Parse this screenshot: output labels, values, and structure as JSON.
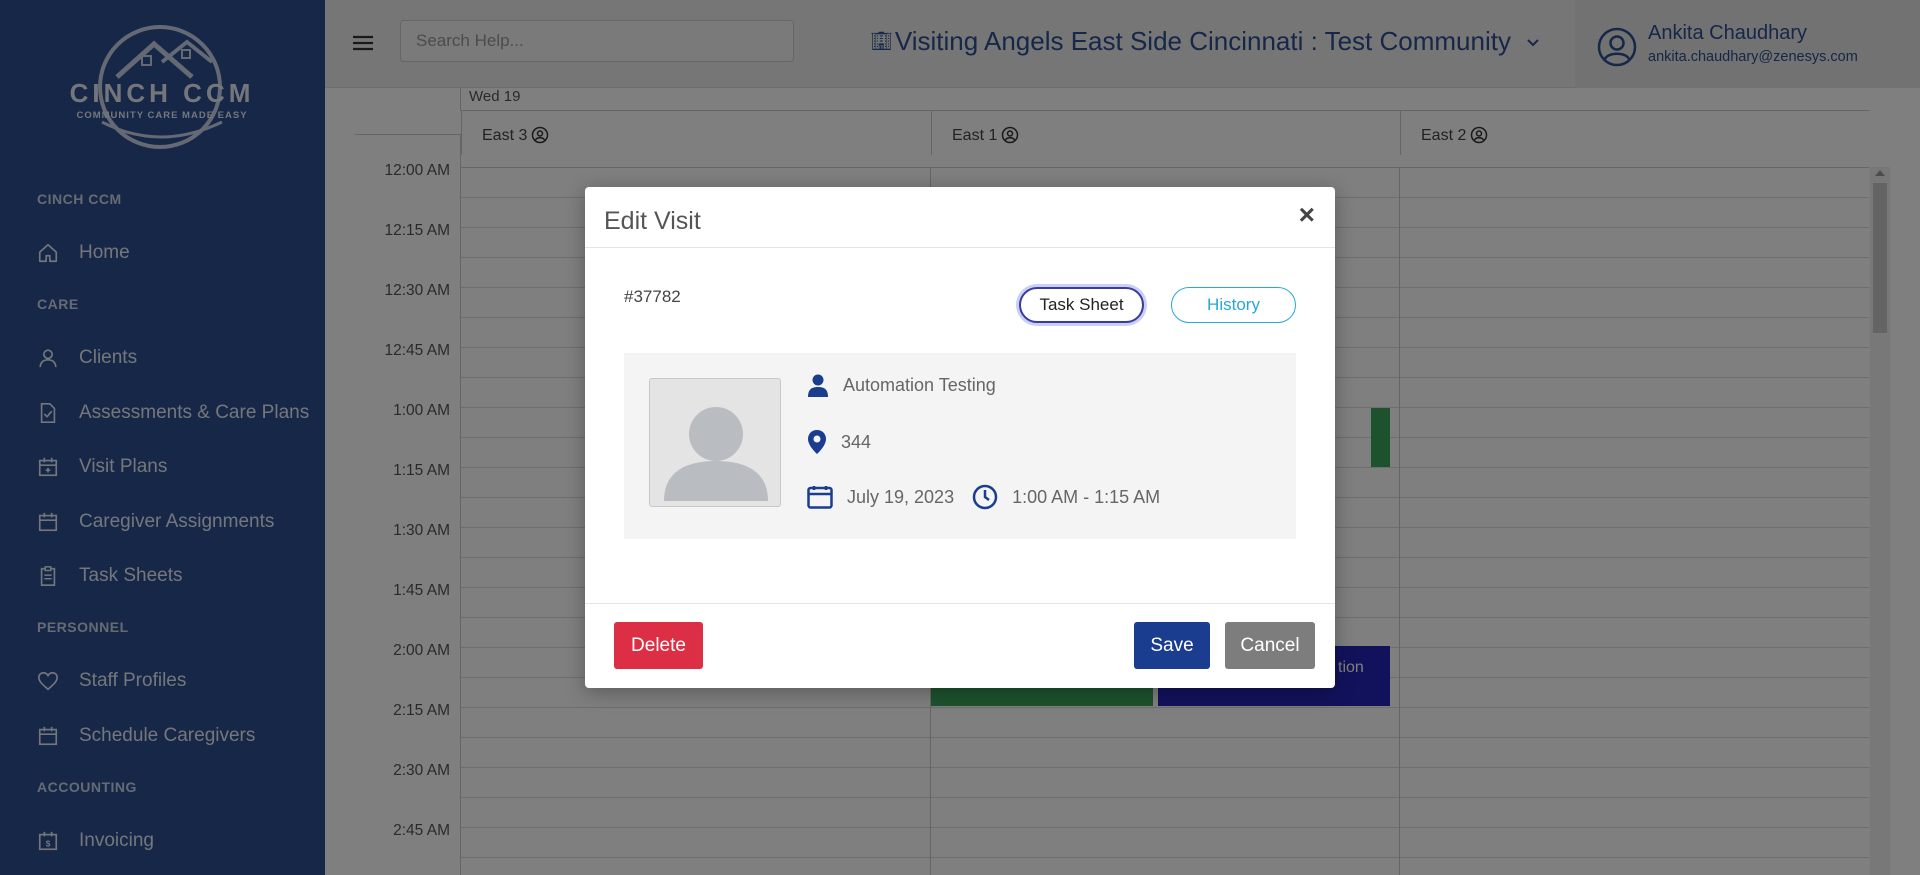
{
  "sidebar": {
    "logo": {
      "title": "CINCH CCM",
      "tagline": "COMMUNITY CARE MADE EASY"
    },
    "sections": [
      {
        "label": "CINCH CCM",
        "items": [
          {
            "label": "Home",
            "icon": "home-icon"
          }
        ]
      },
      {
        "label": "CARE",
        "items": [
          {
            "label": "Clients",
            "icon": "person-icon"
          },
          {
            "label": "Assessments & Care Plans",
            "icon": "document-icon"
          },
          {
            "label": "Visit Plans",
            "icon": "calendar-plus-icon"
          },
          {
            "label": "Caregiver Assignments",
            "icon": "calendar-icon"
          },
          {
            "label": "Task Sheets",
            "icon": "clipboard-icon"
          }
        ]
      },
      {
        "label": "PERSONNEL",
        "items": [
          {
            "label": "Staff Profiles",
            "icon": "heart-badge-icon"
          },
          {
            "label": "Schedule Caregivers",
            "icon": "calendar-icon"
          }
        ]
      },
      {
        "label": "ACCOUNTING",
        "items": [
          {
            "label": "Invoicing",
            "icon": "invoice-icon"
          }
        ]
      }
    ]
  },
  "header": {
    "search_placeholder": "Search Help...",
    "community": "Visiting Angels East Side Cincinnati : Test Community",
    "user_name": "Ankita Chaudhary",
    "user_email": "ankita.chaudhary@zenesys.com"
  },
  "calendar": {
    "day_label": "Wed 19",
    "columns": [
      "East 3",
      "East 1",
      "East 2"
    ],
    "times": [
      "12:00 AM",
      "12:15 AM",
      "12:30 AM",
      "12:45 AM",
      "1:00 AM",
      "1:15 AM",
      "1:30 AM",
      "1:45 AM",
      "2:00 AM",
      "2:15 AM",
      "2:30 AM",
      "2:45 AM"
    ],
    "event_partial_text": "tion",
    "colors": {
      "event_green": "#3da55c",
      "event_blue": "#2424b8"
    }
  },
  "modal": {
    "title": "Edit Visit",
    "close_label": "×",
    "visit_id": "#37782",
    "task_sheet_label": "Task Sheet",
    "history_label": "History",
    "client_name": "Automation Testing",
    "location": "344",
    "date": "July 19, 2023",
    "time": "1:00 AM - 1:15 AM",
    "delete_label": "Delete",
    "save_label": "Save",
    "cancel_label": "Cancel"
  },
  "colors": {
    "sidebar_bg": "#2c4f8f",
    "primary": "#1a3d8f",
    "danger": "#dc2f45",
    "secondary": "#7d7d7d",
    "info": "#27a8d8"
  }
}
